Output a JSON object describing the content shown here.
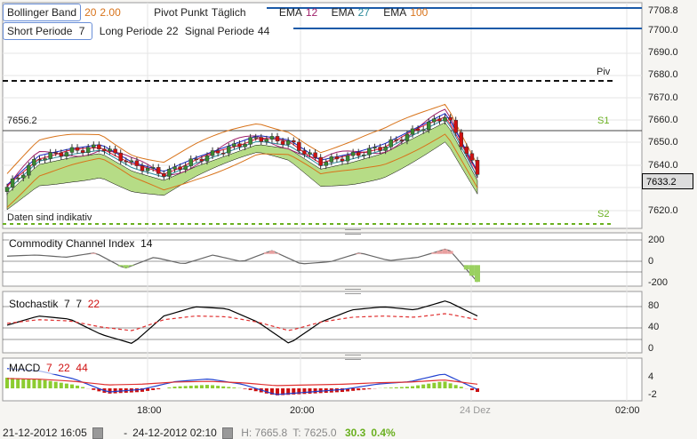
{
  "legend1": {
    "bollinger": "Bollinger Band",
    "bb_p1": "20",
    "bb_p2": "2.00",
    "pivot": "Pivot Punkt",
    "pivot_mode": "Täglich",
    "ema": "EMA",
    "ema1": "12",
    "ema2": "27",
    "ema3": "100"
  },
  "legend2": {
    "short": "Short Periode",
    "short_v": "7",
    "long": "Long Periode",
    "long_v": "22",
    "signal": "Signal Periode",
    "signal_v": "44"
  },
  "price_axis": [
    "7708.8",
    "7700.0",
    "7690.0",
    "7680.0",
    "7670.0",
    "7660.0",
    "7650.0",
    "7640.0",
    "7620.0"
  ],
  "last_price": "7633.2",
  "level_label": "7656.2",
  "pivots": {
    "piv": "Piv",
    "s1": "S1",
    "s2": "S2"
  },
  "disclaimer": "Daten sind indikativ",
  "cci": {
    "label": "Commodity Channel Index",
    "period": "14",
    "axis": [
      "200",
      "0",
      "-200"
    ]
  },
  "stoch": {
    "label": "Stochastik",
    "p1": "7",
    "p2": "7",
    "p3": "22",
    "axis": [
      "80",
      "40",
      "0"
    ]
  },
  "macd": {
    "label": "MACD",
    "p1": "7",
    "p2": "22",
    "p3": "44",
    "axis": [
      "4",
      "-2"
    ]
  },
  "time_axis": [
    "18:00",
    "20:00",
    "24 Dez",
    "02:00"
  ],
  "footer": {
    "from": "21-12-2012 16:05",
    "sep": "-",
    "to": "24-12-2012 02:10",
    "high": "H: 7665.8",
    "low": "T: 7625.0",
    "change": "30.3",
    "pct": "0.4%"
  },
  "colors": {
    "up": "#3a8a30",
    "down": "#d01010",
    "cloud": "#b6dc86"
  },
  "chart_data": {
    "type": "candlestick",
    "close_keypoints": [
      7630,
      7643,
      7646,
      7648,
      7640,
      7636,
      7642,
      7647,
      7652,
      7650,
      7641,
      7644,
      7648,
      7655,
      7662,
      7636
    ],
    "cci_keypoints": [
      30,
      40,
      20,
      60,
      -80,
      20,
      -40,
      40,
      -20,
      80,
      -40,
      -20,
      60,
      -10,
      20,
      100,
      -200
    ],
    "stoch_keypoints": [
      45,
      60,
      55,
      30,
      15,
      60,
      75,
      72,
      50,
      15,
      50,
      70,
      75,
      70,
      85,
      60
    ],
    "macd_keypoints": [
      3,
      2.5,
      1,
      -1.5,
      -1,
      0.5,
      1,
      0,
      -2,
      -1.5,
      -1,
      0,
      0.5,
      2,
      -1
    ]
  }
}
